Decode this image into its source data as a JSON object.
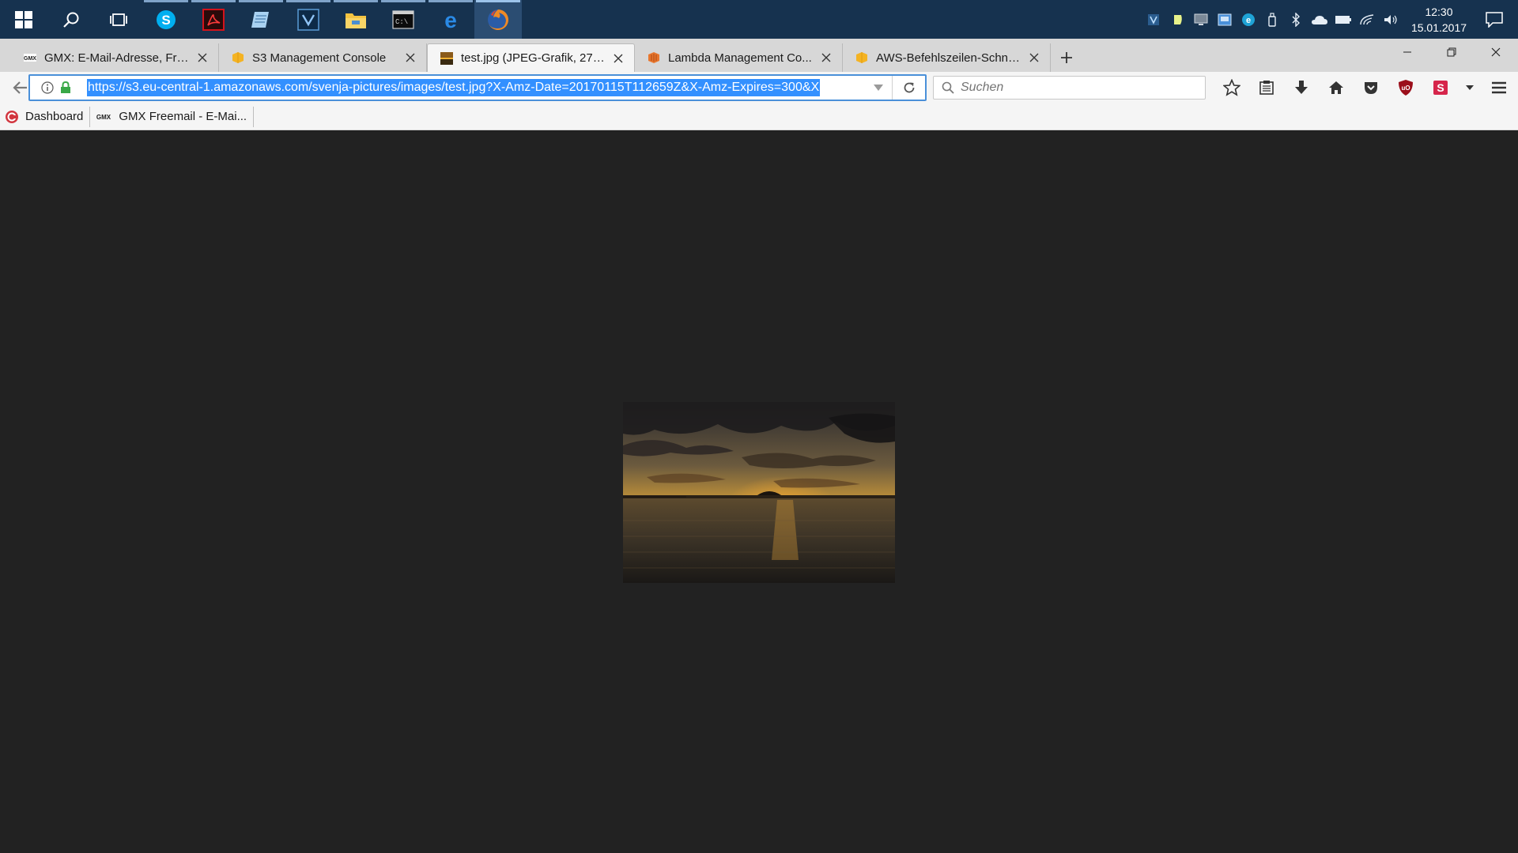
{
  "taskbar": {
    "clock_time": "12:30",
    "clock_date": "15.01.2017",
    "apps": [
      "start-icon",
      "search-icon",
      "task-view-icon",
      "skype-icon",
      "acrobat-icon",
      "notepad-icon",
      "visual-studio-icon",
      "file-explorer-icon",
      "terminal-icon",
      "edge-icon",
      "firefox-icon"
    ]
  },
  "browser": {
    "tabs": [
      {
        "title": "GMX: E-Mail-Adresse, Fre...",
        "favicon": "gmx-icon"
      },
      {
        "title": "S3 Management Console",
        "favicon": "aws-icon"
      },
      {
        "title": "test.jpg (JPEG-Grafik, 275 ...",
        "favicon": "image-icon",
        "selected": true
      },
      {
        "title": "Lambda Management Co...",
        "favicon": "aws-lambda-icon"
      },
      {
        "title": "AWS-Befehlszeilen-Schnit...",
        "favicon": "aws-icon"
      }
    ],
    "url": "https://s3.eu-central-1.amazonaws.com/svenja-pictures/images/test.jpg?X-Amz-Date=20170115T112659Z&X-Amz-Expires=300&X",
    "search_placeholder": "Suchen",
    "bookmarks": [
      {
        "label": "Dashboard",
        "icon": "dashboard-icon"
      },
      {
        "label": "GMX Freemail - E-Mai...",
        "icon": "gmx-icon"
      }
    ]
  },
  "colors": {
    "taskbar": "#16324f",
    "url_selection": "#3390ff",
    "content_background": "#222222"
  }
}
